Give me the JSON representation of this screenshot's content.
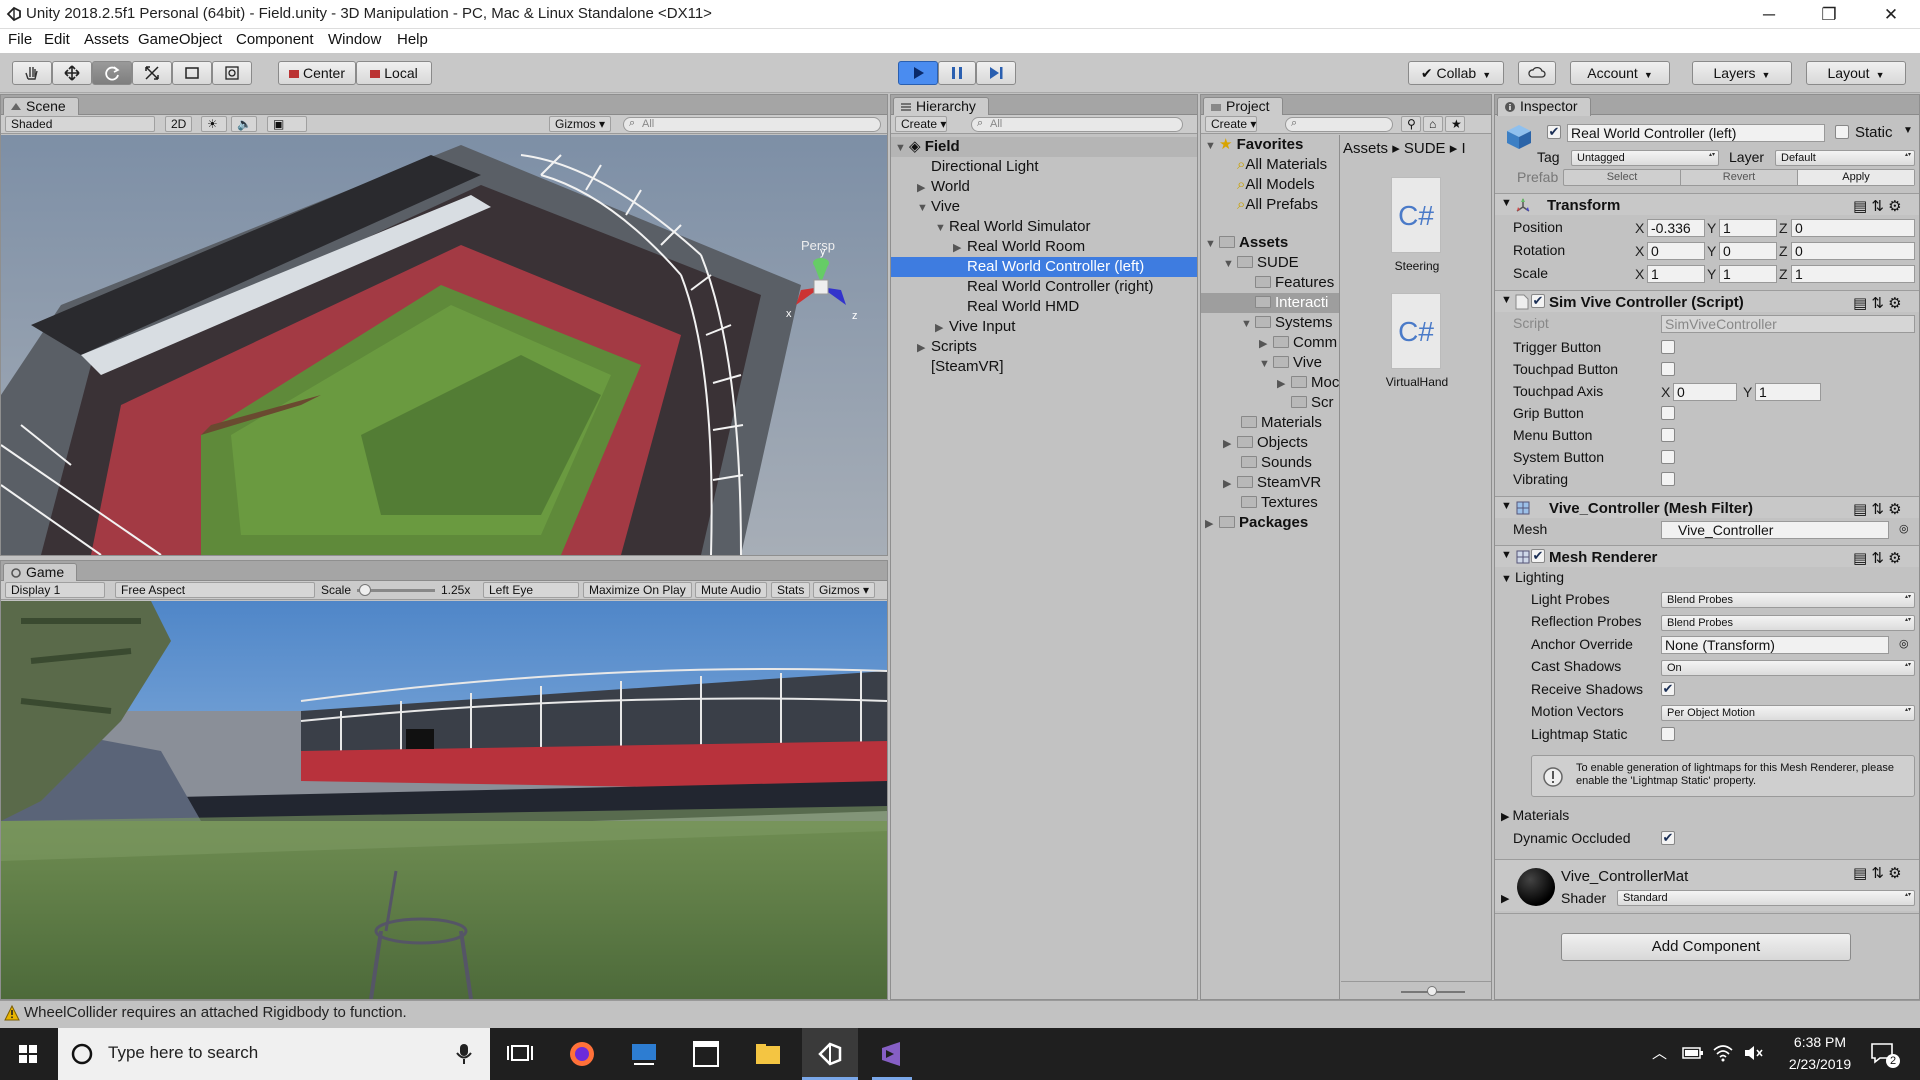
{
  "window": {
    "title": "Unity 2018.2.5f1 Personal (64bit) - Field.unity - 3D Manipulation - PC, Mac & Linux Standalone <DX11>",
    "minimize_glyph": "─",
    "maximize_glyph": "❐",
    "close_glyph": "✕"
  },
  "menu": [
    "File",
    "Edit",
    "Assets",
    "GameObject",
    "Component",
    "Window",
    "Help"
  ],
  "toolbar": {
    "pivot": "Center",
    "space": "Local",
    "collab": "Collab",
    "account": "Account",
    "layers": "Layers",
    "layout": "Layout",
    "play_color": "#4a8cf0"
  },
  "scene": {
    "tab": "Scene",
    "shading": "Shaded",
    "mode_2d": "2D",
    "gizmos": "Gizmos",
    "search_placeholder": "All",
    "persp": "Persp",
    "axis_x": "x",
    "axis_y": "y",
    "axis_z": "z"
  },
  "game": {
    "tab": "Game",
    "display": "Display 1",
    "aspect": "Free Aspect",
    "scale_label": "Scale",
    "scale_value": "1.25x",
    "eye": "Left Eye",
    "maximize": "Maximize On Play",
    "mute": "Mute Audio",
    "stats": "Stats",
    "gizmos": "Gizmos"
  },
  "hierarchy": {
    "tab": "Hierarchy",
    "create": "Create",
    "search_placeholder": "All",
    "scene_name": "Field",
    "rows": [
      {
        "label": "Directional Light"
      },
      {
        "label": "World"
      },
      {
        "label": "Vive"
      },
      {
        "label": "Real World Simulator"
      },
      {
        "label": "Real World Room"
      },
      {
        "label": "Real World Controller (left)"
      },
      {
        "label": "Real World Controller (right)"
      },
      {
        "label": "Real World HMD"
      },
      {
        "label": "Vive Input"
      },
      {
        "label": "Scripts"
      },
      {
        "label": "[SteamVR]"
      }
    ]
  },
  "project": {
    "tab": "Project",
    "create": "Create",
    "favorites": "Favorites",
    "fav_items": [
      "All Materials",
      "All Models",
      "All Prefabs"
    ],
    "assets": "Assets",
    "asset_tree": [
      "SUDE",
      "Features",
      "Interacti",
      "Systems",
      "Comm",
      "Vive",
      "Moc",
      "Scr",
      "Materials",
      "Objects",
      "Sounds",
      "SteamVR",
      "Textures"
    ],
    "packages": "Packages",
    "breadcrumb": [
      "Assets",
      "SUDE",
      "I"
    ],
    "breadcrumb_sep": "▸",
    "files": [
      {
        "icon": "C#",
        "name": "Steering"
      },
      {
        "icon": "C#",
        "name": "VirtualHand"
      }
    ]
  },
  "inspector": {
    "tab": "Inspector",
    "object_name": "Real World Controller (left)",
    "static_label": "Static",
    "tag_label": "Tag",
    "tag_value": "Untagged",
    "layer_label": "Layer",
    "layer_value": "Default",
    "prefab_label": "Prefab",
    "prefab_select": "Select",
    "prefab_revert": "Revert",
    "prefab_apply": "Apply",
    "transform": {
      "title": "Transform",
      "position_label": "Position",
      "rotation_label": "Rotation",
      "scale_label": "Scale",
      "position": [
        "-0.336",
        "1",
        "0"
      ],
      "rotation": [
        "0",
        "0",
        "0"
      ],
      "scale": [
        "1",
        "1",
        "1"
      ],
      "x": "X",
      "y": "Y",
      "z": "Z"
    },
    "script": {
      "title": "Sim Vive Controller (Script)",
      "script_label": "Script",
      "script_value": "SimViveController",
      "props": [
        "Trigger Button",
        "Touchpad Button",
        "Touchpad Axis",
        "Grip Button",
        "Menu Button",
        "System Button",
        "Vibrating"
      ],
      "axis_x": "0",
      "axis_y": "1"
    },
    "mesh_filter": {
      "title": "Vive_Controller (Mesh Filter)",
      "mesh_label": "Mesh",
      "mesh_value": "Vive_Controller"
    },
    "mesh_renderer": {
      "title": "Mesh Renderer",
      "lighting": "Lighting",
      "light_probes_label": "Light Probes",
      "light_probes_value": "Blend Probes",
      "reflection_probes_label": "Reflection Probes",
      "reflection_probes_value": "Blend Probes",
      "anchor_label": "Anchor Override",
      "anchor_value": "None (Transform)",
      "cast_label": "Cast Shadows",
      "cast_value": "On",
      "receive_label": "Receive Shadows",
      "motion_label": "Motion Vectors",
      "motion_value": "Per Object Motion",
      "lightmap_label": "Lightmap Static",
      "info": "To enable generation of lightmaps for this Mesh Renderer, please enable the 'Lightmap Static' property.",
      "materials": "Materials",
      "dynamic_label": "Dynamic Occluded"
    },
    "material": {
      "name": "Vive_ControllerMat",
      "shader_label": "Shader",
      "shader_value": "Standard"
    },
    "add_component": "Add Component"
  },
  "status": {
    "message": "WheelCollider requires an attached Rigidbody to function."
  },
  "taskbar": {
    "search_placeholder": "Type here to search",
    "time": "6:38 PM",
    "date": "2/23/2019",
    "notif_count": "2"
  }
}
